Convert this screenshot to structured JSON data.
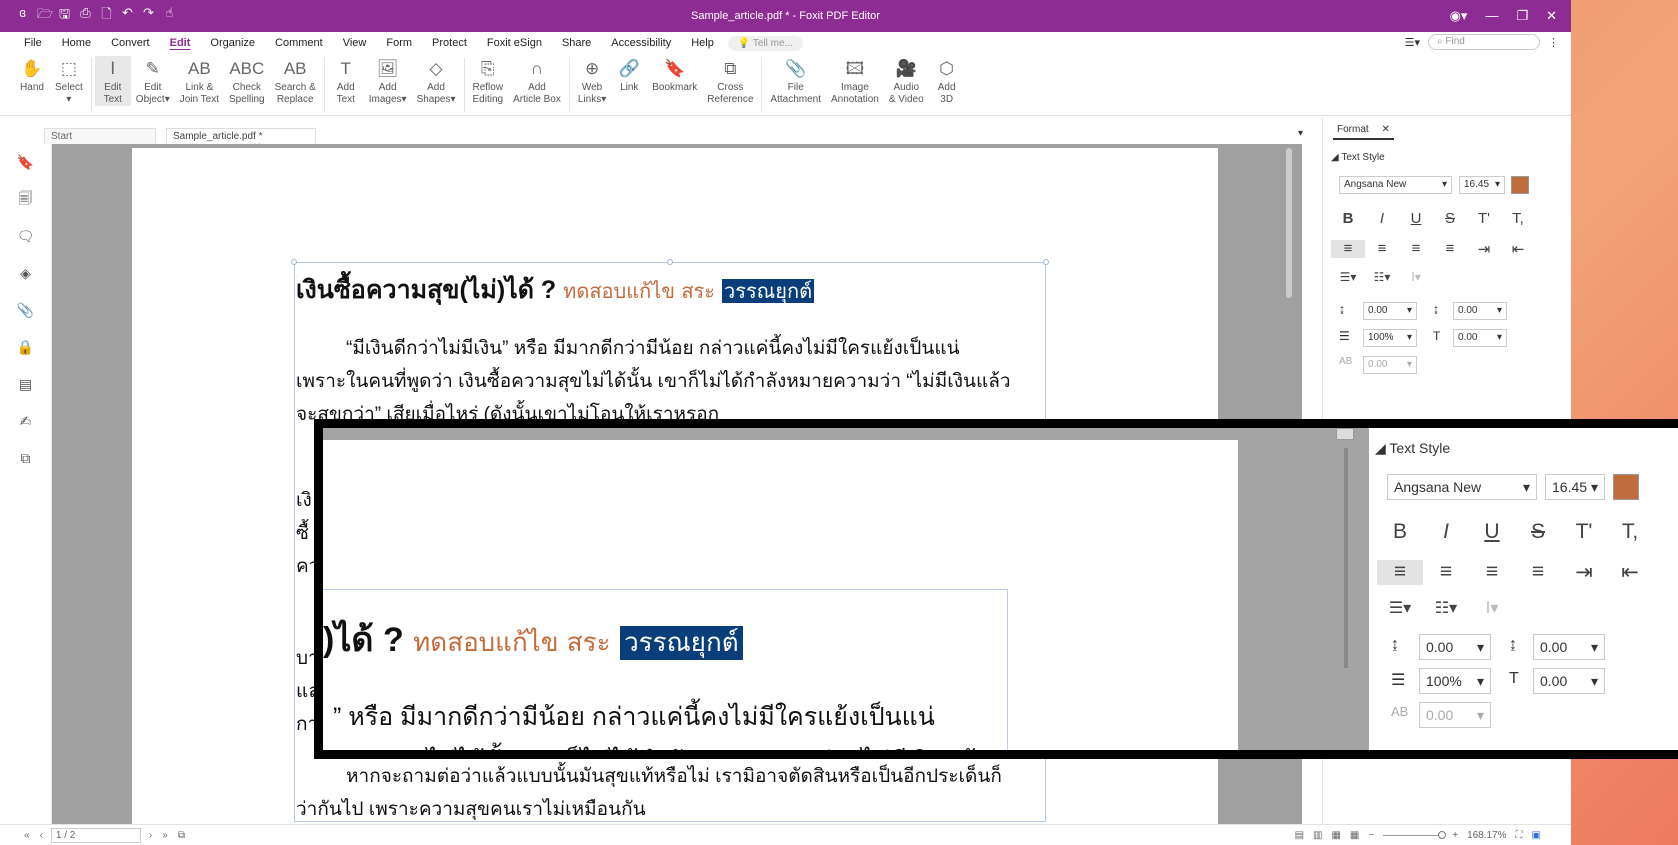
{
  "window": {
    "title": "Sample_article.pdf * - Foxit PDF Editor"
  },
  "quick_access": [
    "logo-icon",
    "open-icon",
    "save-icon",
    "print-icon",
    "new-icon",
    "undo-icon",
    "redo-icon",
    "hand-tool-icon"
  ],
  "menu": {
    "items": [
      "File",
      "Home",
      "Convert",
      "Edit",
      "Organize",
      "Comment",
      "View",
      "Form",
      "Protect",
      "Foxit eSign",
      "Share",
      "Accessibility",
      "Help"
    ],
    "active": "Edit",
    "tell_me": "Tell me...",
    "find_placeholder": "Find"
  },
  "ribbon": [
    {
      "l1": "Hand",
      "l2": "",
      "icon": "✋"
    },
    {
      "l1": "Select",
      "l2": "▾",
      "icon": "⬚"
    },
    {
      "l1": "Edit",
      "l2": "Text",
      "icon": "Ⅰ",
      "selected": true
    },
    {
      "l1": "Edit",
      "l2": "Object▾",
      "icon": "✎"
    },
    {
      "l1": "Link &",
      "l2": "Join Text",
      "icon": "AB"
    },
    {
      "l1": "Check",
      "l2": "Spelling",
      "icon": "ABC"
    },
    {
      "l1": "Search &",
      "l2": "Replace",
      "icon": "AB"
    },
    {
      "l1": "Add",
      "l2": "Text",
      "icon": "T"
    },
    {
      "l1": "Add",
      "l2": "Images▾",
      "icon": "🖼"
    },
    {
      "l1": "Add",
      "l2": "Shapes▾",
      "icon": "◇"
    },
    {
      "l1": "Reflow",
      "l2": "Editing",
      "icon": "⎘"
    },
    {
      "l1": "Add",
      "l2": "Article Box",
      "icon": "∩"
    },
    {
      "l1": "Web",
      "l2": "Links▾",
      "icon": "⊕"
    },
    {
      "l1": "Link",
      "l2": "",
      "icon": "🔗"
    },
    {
      "l1": "Bookmark",
      "l2": "",
      "icon": "🔖"
    },
    {
      "l1": "Cross",
      "l2": "Reference",
      "icon": "⧉"
    },
    {
      "l1": "File",
      "l2": "Attachment",
      "icon": "📎"
    },
    {
      "l1": "Image",
      "l2": "Annotation",
      "icon": "🖾"
    },
    {
      "l1": "Audio",
      "l2": "& Video",
      "icon": "🎥"
    },
    {
      "l1": "Add",
      "l2": "3D",
      "icon": "⬡"
    }
  ],
  "tabs": {
    "start": "Start",
    "doc": "Sample_article.pdf *"
  },
  "document": {
    "title_bold": "เงินซื้อความสุข(ไม่)ได้ ?",
    "title_sub": "ทดสอบแก้ไข สระ",
    "title_highlight": "วรรณยุกต์",
    "para1_l1": "“มีเงินดีกว่าไม่มีเงิน” หรือ มีมากดีกว่ามีน้อย กล่าวแค่นี้คงไม่มีใครแย้งเป็นแน่",
    "para1_l2": "เพราะในคนที่พูดว่า เงินซื้อความสุขไม่ได้นั้น เขาก็ไม่ได้กำลังหมายความว่า “ไม่มีเงินแล้ว",
    "para1_l3": "จะสุขกว่า” เสียเมื่อไหร่ (ดังนั้นเขาไม่โอนให้เราหรอก",
    "side_fragments": [
      "เงิ",
      "ซื้",
      "คว",
      "บา",
      "แล",
      "กา"
    ],
    "para_last_l1": "หากจะถามต่อว่าแล้วแบบนั้นมันสุขแท้หรือไม่ เรามิอาจตัดสินหรือเป็นอีกประเด็นก็",
    "para_last_l2": "ว่ากันไป เพราะความสุขคนเราไม่เหมือนกัน"
  },
  "format_panel": {
    "tab": "Format",
    "section": "Text Style",
    "font": "Angsana New",
    "size": "16.45",
    "color": "#bf6d3a",
    "style_icons": [
      "B",
      "I",
      "U",
      "S",
      "T'",
      "T,"
    ],
    "align_icons": [
      "≡",
      "≡",
      "≡",
      "≡",
      "⇥",
      "⇤"
    ],
    "line_spacing": "0.00",
    "para_spacing": "0.00",
    "scale": "100%",
    "char_spacing": "0.00",
    "word_spacing": "0.00"
  },
  "zoom_view": {
    "title_bold": ")ได้ ?",
    "title_sub": "ทดสอบแก้ไข สระ",
    "title_highlight": "วรรณยุกต์",
    "para_l1": "” หรือ มีมากดีกว่ามีน้อย กล่าวแค่นี้คงไม่มีใครแย้งเป็นแน่",
    "para_l2": "ความสุขไม่ได้นั้น เขาก็ไม่ได้กำลังหมายความว่า “ไม่มีเงินแล้ว"
  },
  "status": {
    "page": "1 / 2",
    "zoom": "168.17%"
  }
}
